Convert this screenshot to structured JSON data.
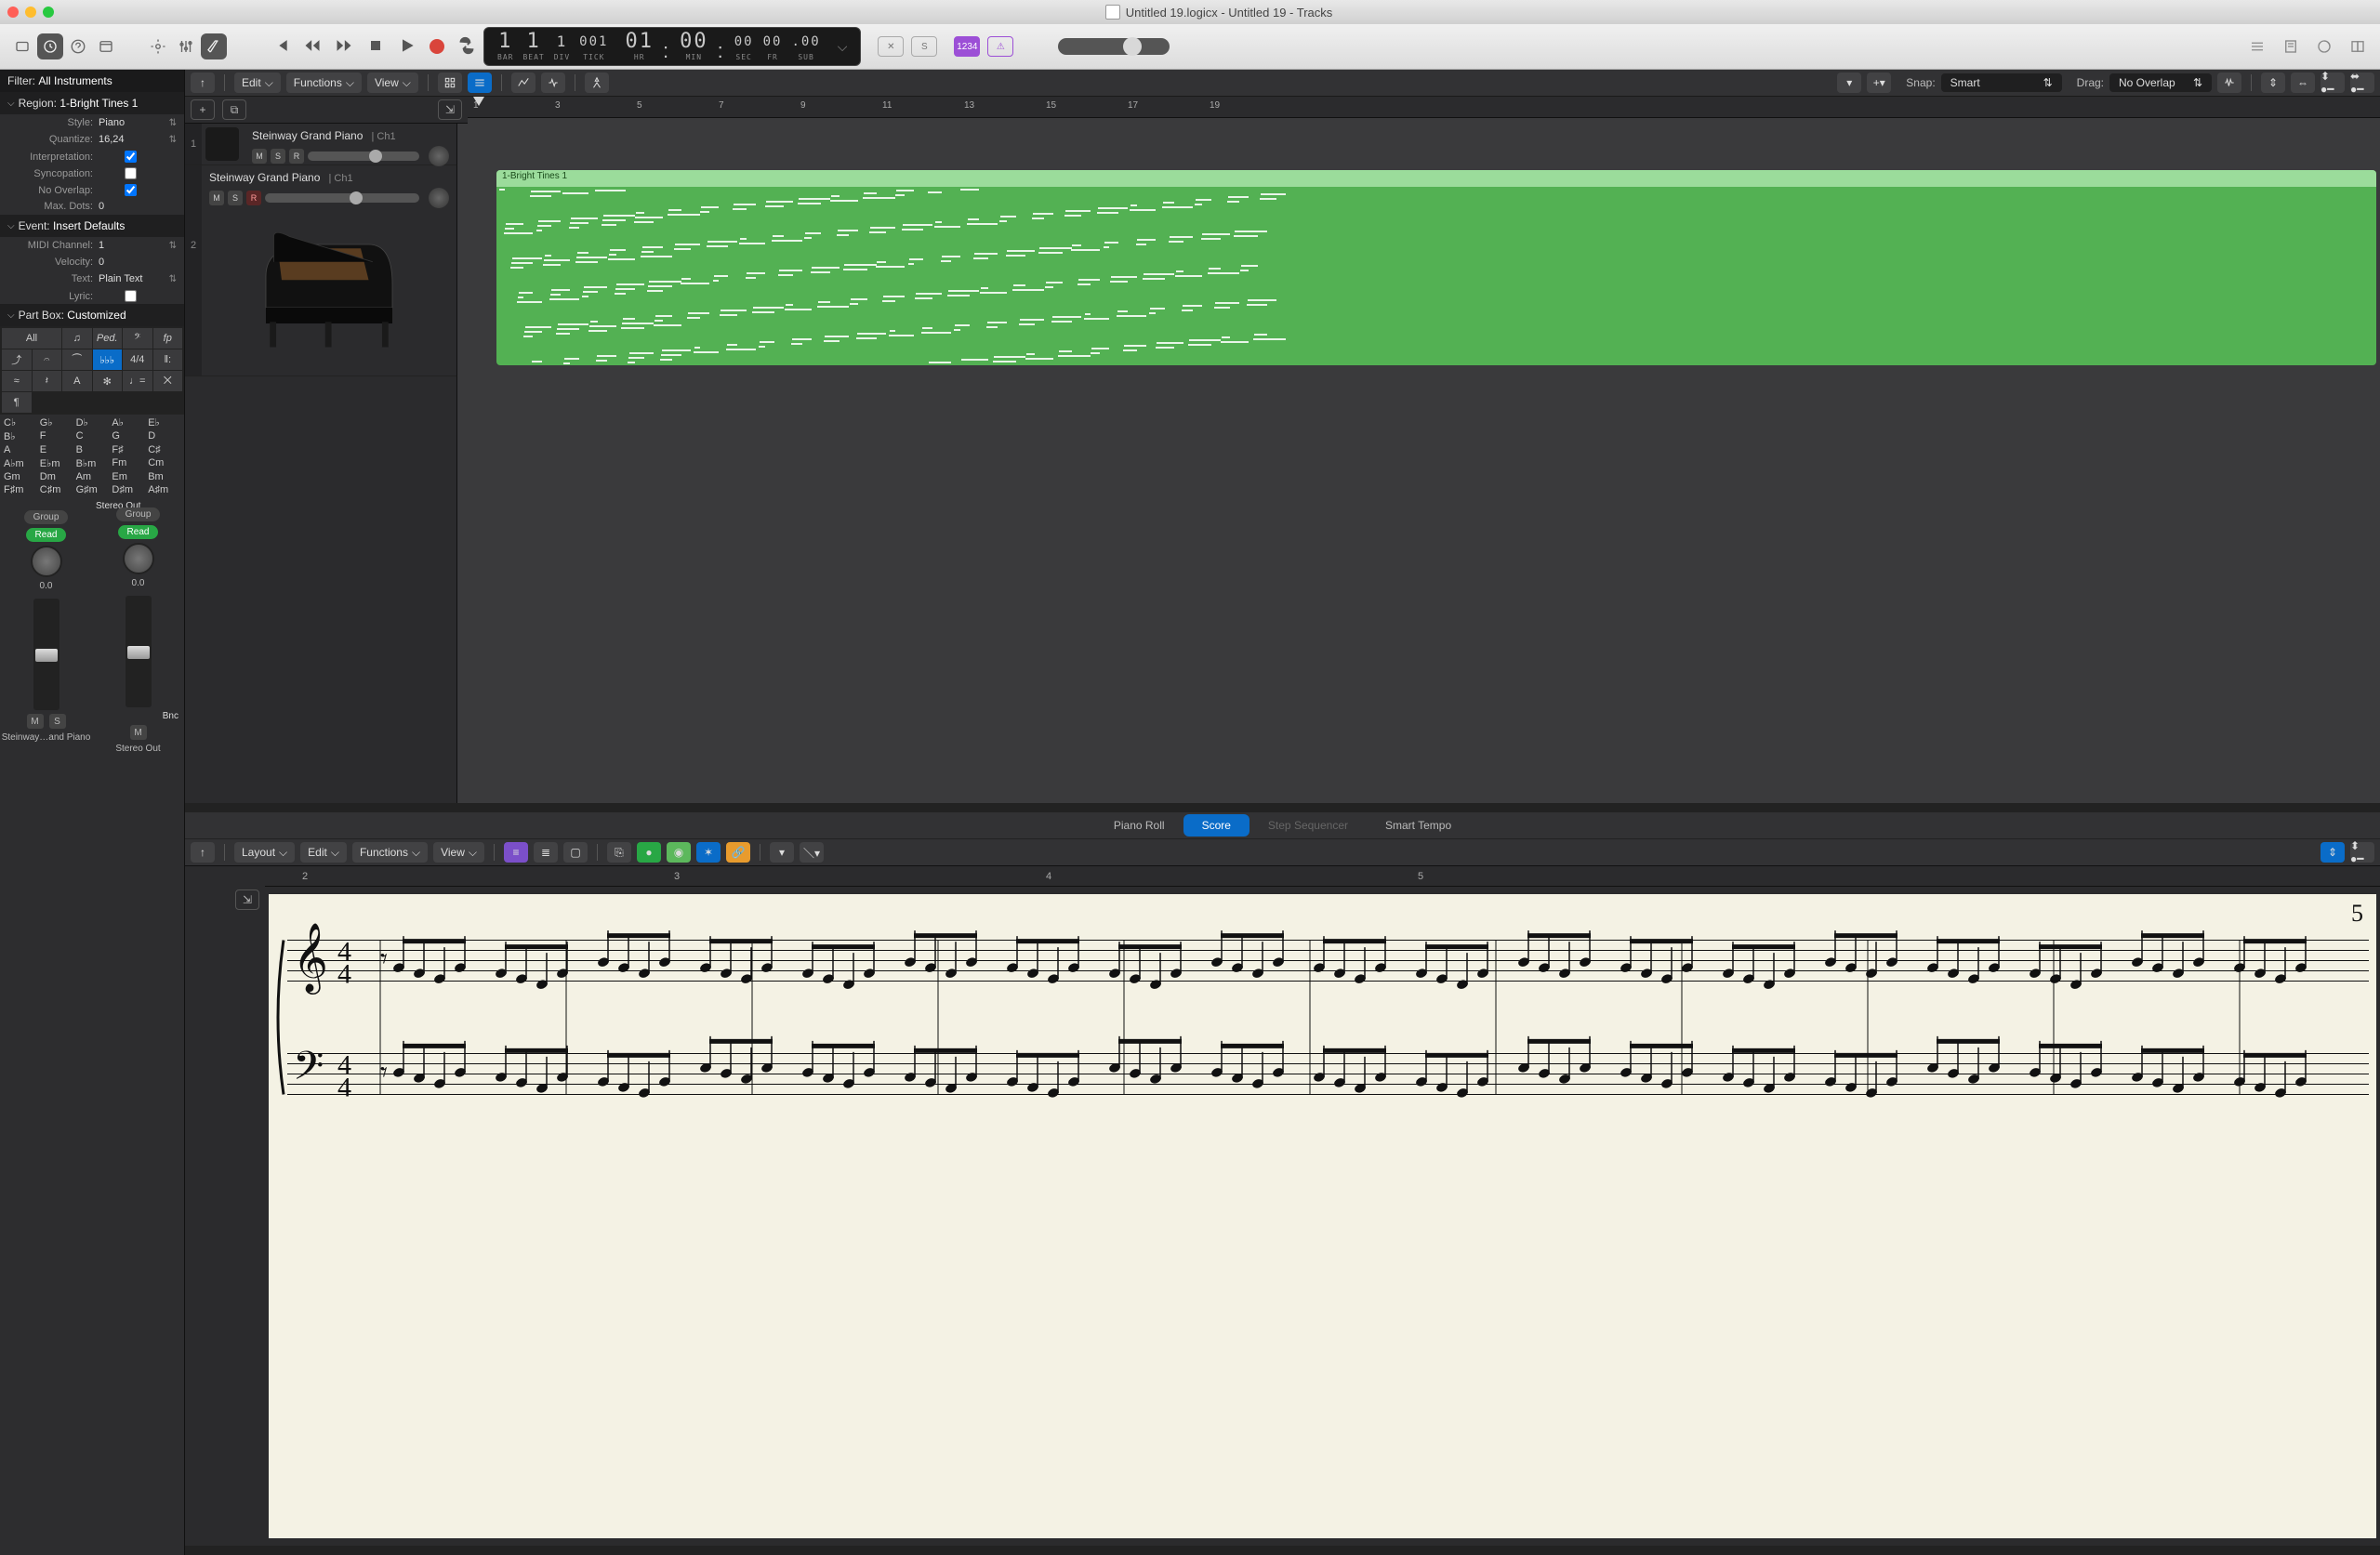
{
  "window": {
    "title": "Untitled 19.logicx - Untitled 19 - Tracks"
  },
  "transport": {
    "bar": "1",
    "beat": "1",
    "div": "1",
    "tick": "001",
    "bar_lbl": "BAR",
    "beat_lbl": "BEAT",
    "div_lbl": "DIV",
    "tick_lbl": "TICK",
    "hr": "01",
    "min": "00",
    "sec": "00",
    "fr": "00",
    "sub": "00",
    "hr_lbl": "HR",
    "min_lbl": "MIN",
    "sec_lbl": "SEC",
    "fr_lbl": "FR",
    "sub_lbl": "SUB",
    "time_colon": ":",
    "time_fine": ".00",
    "badge_x": "✕",
    "badge_s": "S",
    "badge_1234": "1234",
    "badge_warn": "⚠"
  },
  "inspector": {
    "filter_label": "Filter:",
    "filter_value": "All Instruments",
    "region_label": "Region:",
    "region_value": "1-Bright Tines 1",
    "rows": {
      "style_lbl": "Style:",
      "style_val": "Piano",
      "quant_lbl": "Quantize:",
      "quant_val": "16,24",
      "interp_lbl": "Interpretation:",
      "sync_lbl": "Syncopation:",
      "noover_lbl": "No Overlap:",
      "maxdots_lbl": "Max. Dots:",
      "maxdots_val": "0"
    },
    "event_label": "Event:",
    "event_value": "Insert Defaults",
    "event_rows": {
      "midi_lbl": "MIDI Channel:",
      "midi_val": "1",
      "vel_lbl": "Velocity:",
      "vel_val": "0",
      "text_lbl": "Text:",
      "text_val": "Plain Text",
      "lyric_lbl": "Lyric:"
    },
    "partbox_label": "Part Box:",
    "partbox_value": "Customized",
    "pb_all": "All",
    "keys": [
      "C♭",
      "G♭",
      "D♭",
      "A♭",
      "E♭",
      "B♭",
      "F",
      "C",
      "G",
      "D",
      "A",
      "E",
      "B",
      "F♯",
      "C♯",
      "A♭m",
      "E♭m",
      "B♭m",
      "Fm",
      "Cm",
      "Gm",
      "Dm",
      "Am",
      "Em",
      "Bm",
      "F♯m",
      "C♯m",
      "G♯m",
      "D♯m",
      "A♯m"
    ],
    "mixer": {
      "stereo_out": "Stereo Out",
      "bnc": "Bnc",
      "group": "Group",
      "read": "Read",
      "zero": "0.0",
      "m": "M",
      "s": "S",
      "ch1_name": "Steinway…and Piano",
      "ch2_name": "Stereo Out"
    }
  },
  "tracks_tb": {
    "edit": "Edit",
    "functions": "Functions",
    "view": "View",
    "snap_lbl": "Snap:",
    "snap_val": "Smart",
    "drag_lbl": "Drag:",
    "drag_val": "No Overlap"
  },
  "tracks": {
    "t1": {
      "name": "Steinway Grand Piano",
      "ch": "Ch1",
      "m": "M",
      "s": "S",
      "r": "R"
    },
    "t2": {
      "name": "Steinway Grand Piano",
      "ch": "Ch1",
      "m": "M",
      "s": "S",
      "r": "R"
    },
    "region_name": "1-Bright Tines 1"
  },
  "ruler_marks": [
    "1",
    "3",
    "5",
    "7",
    "9",
    "11",
    "13",
    "15",
    "17",
    "19"
  ],
  "editor_tabs": {
    "pianoroll": "Piano Roll",
    "score": "Score",
    "stepseq": "Step Sequencer",
    "smarttempo": "Smart Tempo"
  },
  "editor_tb": {
    "layout": "Layout",
    "edit": "Edit",
    "functions": "Functions",
    "view": "View"
  },
  "score_ruler": [
    "2",
    "3",
    "4",
    "5"
  ],
  "score_barnum": "5",
  "timesig": {
    "num": "4",
    "den": "4"
  }
}
